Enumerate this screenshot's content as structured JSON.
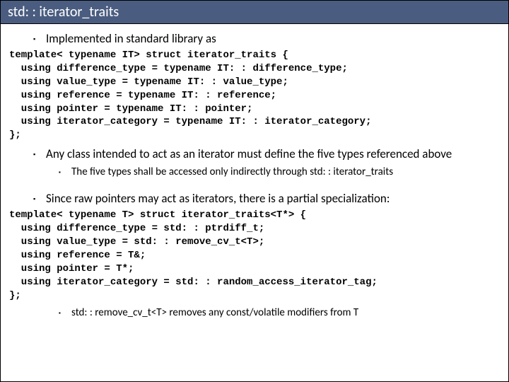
{
  "title": "std: : iterator_traits",
  "bullets": {
    "b1": "Implemented in standard library as",
    "b2": "Any class intended to act as an iterator must define the five types referenced above",
    "b2a": "The five types shall be accessed only indirectly through std: : iterator_traits",
    "b3": "Since raw pointers may act as iterators, there is a partial specialization:",
    "b4": "std: : remove_cv_t<T> removes any const/volatile modifiers from T"
  },
  "code1": "template< typename IT> struct iterator_traits {\n  using difference_type = typename IT: : difference_type;\n  using value_type = typename IT: : value_type;\n  using reference = typename IT: : reference;\n  using pointer = typename IT: : pointer;\n  using iterator_category = typename IT: : iterator_category;\n};",
  "code2": "template< typename T> struct iterator_traits<T*> {\n  using difference_type = std: : ptrdiff_t;\n  using value_type = std: : remove_cv_t<T>;\n  using reference = T&;\n  using pointer = T*;\n  using iterator_category = std: : random_access_iterator_tag;\n};"
}
